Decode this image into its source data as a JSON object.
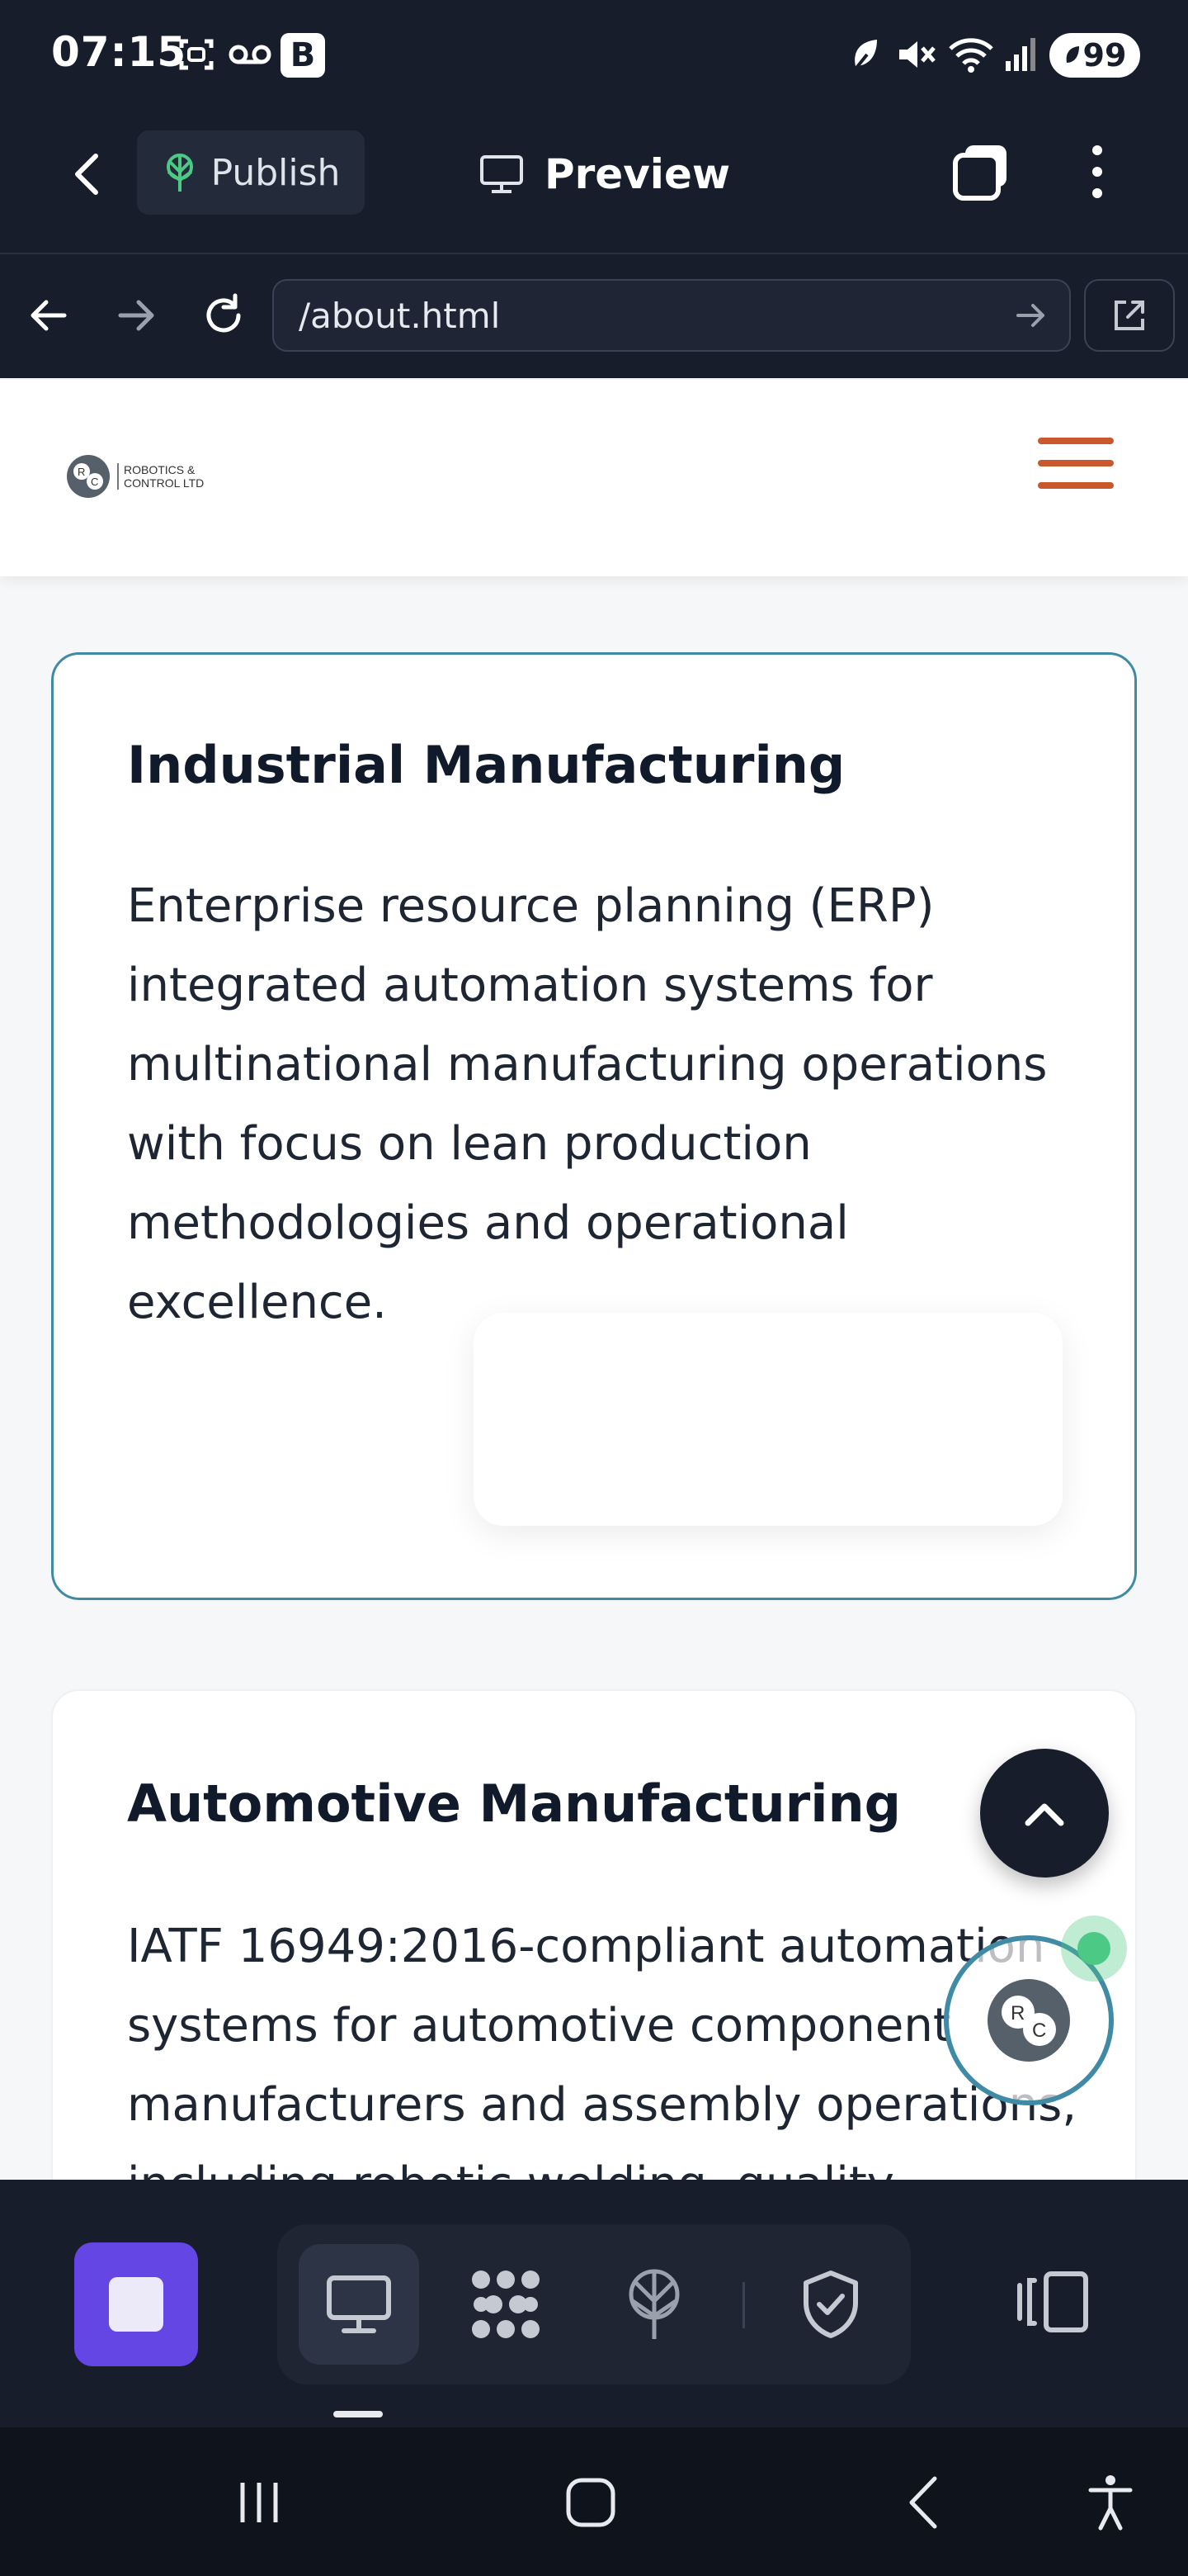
{
  "status_bar": {
    "time": "07:15",
    "b_badge": "B",
    "battery": "99",
    "icons": [
      "screenshot-icon",
      "voicemail-icon",
      "leaf-icon",
      "mute-icon",
      "wifi-icon",
      "signal-icon"
    ]
  },
  "app_bar": {
    "publish_label": "Publish",
    "preview_label": "Preview"
  },
  "url_bar": {
    "url": "/about.html"
  },
  "site_header": {
    "logo_line1": "ROBOTICS &",
    "logo_line2": "CONTROL LTD",
    "logo_mark": "R C"
  },
  "cards": [
    {
      "title": "Industrial Manufacturing",
      "body": "Enterprise resource planning (ERP) integrated automation systems for multinational manufacturing operations with focus on lean production methodologies and operational excellence."
    },
    {
      "title": "Automotive Manufacturing",
      "body": "IATF 16949:2016-compliant automation systems for automotive component manufacturers and assembly operations, including robotic welding, quality"
    }
  ],
  "toolbar": {
    "tools": [
      "desktop-icon",
      "apps-icon",
      "publish-tree-icon",
      "shield-check-icon"
    ],
    "active_tool": "desktop-icon"
  },
  "colors": {
    "dark_bg": "#171d2b",
    "accent_teal": "#3f8aa4",
    "accent_orange": "#c9582c",
    "stop_purple": "#6446e4",
    "online_green": "#4cc985"
  }
}
